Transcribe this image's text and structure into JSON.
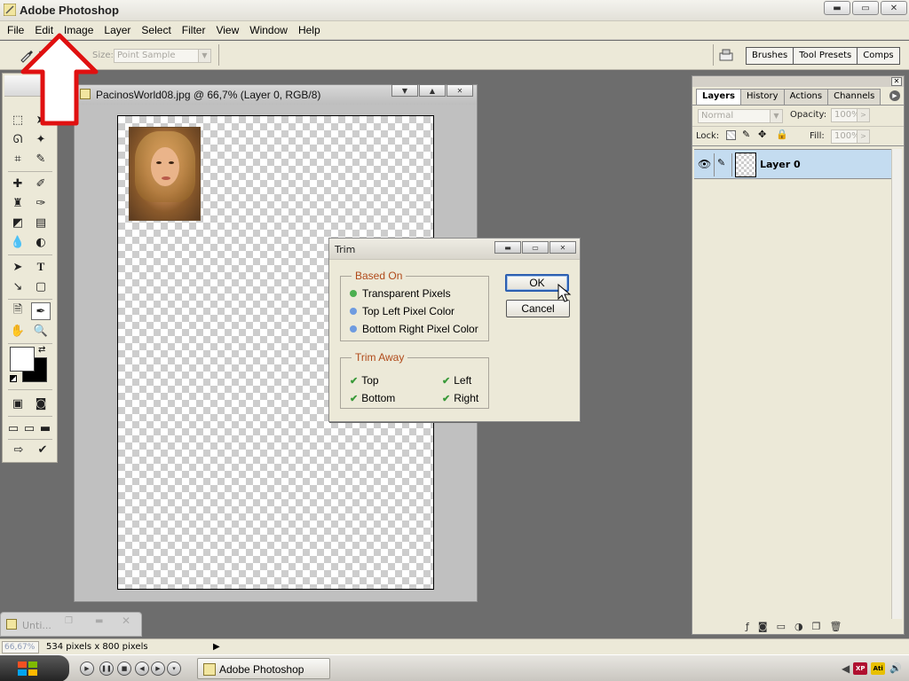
{
  "app": {
    "title": "Adobe Photoshop"
  },
  "window_buttons": {
    "minimize": "▬",
    "restore": "▭",
    "close": "✕"
  },
  "menu": [
    "File",
    "Edit",
    "Image",
    "Layer",
    "Select",
    "Filter",
    "View",
    "Window",
    "Help"
  ],
  "options_bar": {
    "sample_size_label": "Size:",
    "sample_size_value": "Point Sample",
    "palette_well_tabs": [
      "Brushes",
      "Tool Presets",
      "Comps"
    ]
  },
  "document": {
    "title": "PacinosWorld08.jpg @ 66,7% (Layer 0, RGB/8)"
  },
  "trim_dialog": {
    "title": "Trim",
    "based_on": {
      "legend": "Based On",
      "options": [
        {
          "label": "Transparent Pixels",
          "color": "#4caf50"
        },
        {
          "label": "Top Left Pixel Color",
          "color": "#6e9be0"
        },
        {
          "label": "Bottom Right Pixel Color",
          "color": "#6e9be0"
        }
      ]
    },
    "trim_away": {
      "legend": "Trim Away",
      "checks": [
        "Top",
        "Left",
        "Bottom",
        "Right"
      ]
    },
    "ok_label": "OK",
    "cancel_label": "Cancel"
  },
  "layers_panel": {
    "tabs": [
      "Layers",
      "History",
      "Actions",
      "Channels"
    ],
    "blend_mode": "Normal",
    "opacity_label": "Opacity:",
    "opacity_value": "100%",
    "lock_label": "Lock:",
    "fill_label": "Fill:",
    "fill_value": "100%",
    "layer_name": "Layer 0"
  },
  "minimized_doc": {
    "title": "Unti..."
  },
  "status_bar": {
    "zoom": "66,67%",
    "info": "534 pixels x 800 pixels"
  },
  "taskbar": {
    "item_label": "Adobe Photoshop",
    "tray": [
      "XP",
      "Ati"
    ]
  },
  "colors": {
    "accent_red": "#e01010",
    "selected_layer": "#c4dcf0",
    "legend_text": "#b04a1a"
  }
}
